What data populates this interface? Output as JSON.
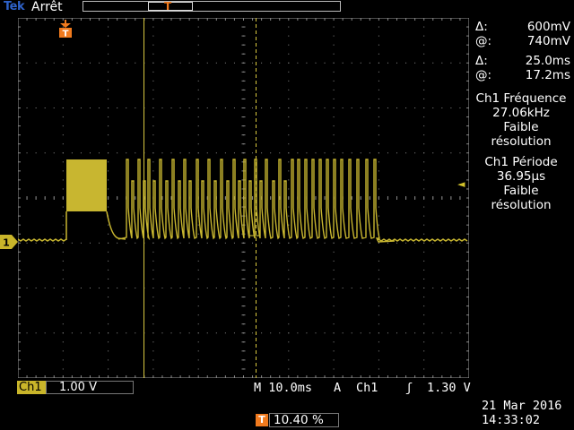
{
  "header": {
    "logo": "Tek",
    "status": "Arrêt",
    "record_trigger_label": "T"
  },
  "screen": {
    "trigger_marker_label": "T",
    "ch1_marker_label": "1",
    "trigger_level_arrow": "◄"
  },
  "cursors": {
    "v_delta_symbol": "Δ:",
    "v_delta": "600mV",
    "v_at_symbol": "@:",
    "v_at": "740mV",
    "t_delta_symbol": "Δ:",
    "t_delta": "25.0ms",
    "t_at_symbol": "@:",
    "t_at": "17.2ms"
  },
  "measurements": [
    {
      "title": "Ch1 Fréquence",
      "value": "27.06kHz",
      "note1": "Faible",
      "note2": "résolution"
    },
    {
      "title": "Ch1 Période",
      "value": "36.95µs",
      "note1": "Faible",
      "note2": "résolution"
    }
  ],
  "footer": {
    "channel": "Ch1",
    "volts_div": "1.00 V",
    "timebase": "M 10.0ms",
    "trigger_mode": "A",
    "trigger_source": "Ch1",
    "trigger_slope": "ʃ",
    "trigger_level": "1.30 V",
    "date": "21 Mar  2016",
    "time": "14:33:02",
    "trigger_pos_icon": "T",
    "trigger_position": "10.40 %"
  },
  "colors": {
    "trace": "#c8b630",
    "trigger": "#f07a1e",
    "grid": "#8a8a8a",
    "cursor": "#d8c840"
  }
}
